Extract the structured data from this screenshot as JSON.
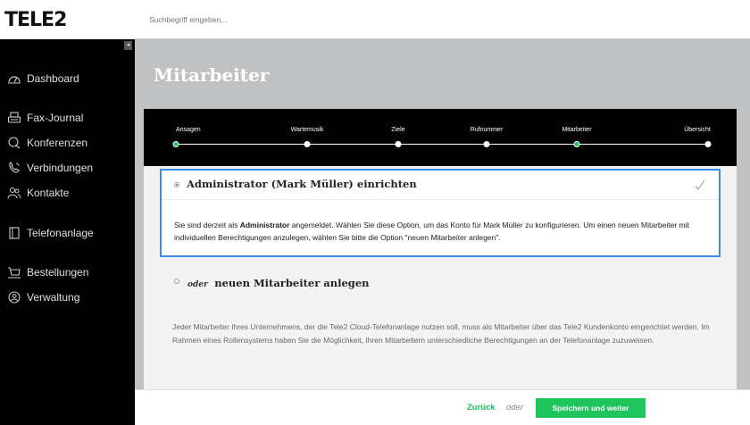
{
  "brand": {
    "logo": "TELE2"
  },
  "search": {
    "placeholder": "Suchbegriff eingeben..."
  },
  "sidebar": {
    "collapse_glyph": "◂",
    "items": [
      {
        "label": "Dashboard",
        "icon": "gauge-icon"
      },
      {
        "label": "Fax-Journal",
        "icon": "fax-icon"
      },
      {
        "label": "Konferenzen",
        "icon": "chat-icon"
      },
      {
        "label": "Verbindungen",
        "icon": "phone-icon"
      },
      {
        "label": "Kontakte",
        "icon": "contacts-icon"
      },
      {
        "label": "Telefonanlage",
        "icon": "phone-system-icon"
      },
      {
        "label": "Bestellungen",
        "icon": "cart-icon"
      },
      {
        "label": "Verwaltung",
        "icon": "user-circle-icon"
      }
    ]
  },
  "main": {
    "title": "Mitarbeiter"
  },
  "steps": {
    "items": [
      {
        "label": "Ansagen",
        "active": true
      },
      {
        "label": "Wartemusik",
        "active": false
      },
      {
        "label": "Ziele",
        "active": false
      },
      {
        "label": "Rufnummer",
        "active": false
      },
      {
        "label": "Mitarbeiter",
        "active": true
      },
      {
        "label": "Übersicht",
        "active": false
      }
    ]
  },
  "option1": {
    "title": "Administrator (Mark Müller) einrichten",
    "desc_part1": "Sie sind derzeit als ",
    "desc_bold": "Administrator",
    "desc_part2": " angemeldet. Wählen Sie diese Option, um das Konto für Mark Müller zu konfigurieren. Um einen neuen Mitarbeiter mit individuellen Berechtigungen anzulegen, wählen Sie bitte die Option \"neuen Mitarbeiter anlegen\".",
    "selected": true
  },
  "option2": {
    "prefix": "oder",
    "title": "neuen Mitarbeiter anlegen",
    "desc": "Jeder Mitarbeiter Ihres Unternehmens, der die Tele2 Cloud-Telefonanlage nutzen soll, muss als Mitarbeiter über das Tele2 Kundenkonto eingerichtet werden. Im Rahmen eines Rollensystems haben Sie die Möglichkeit, Ihren Mitarbeitern unterschiedliche Berechtigungen an der Telefonanlage zuzuweisen.",
    "selected": false
  },
  "footer": {
    "back_label": "Zurück",
    "or_label": "oder",
    "save_label": "Speichern und weiter"
  },
  "colors": {
    "accent": "#1fc45a",
    "selection_border": "#3a8ee6",
    "sidebar_bg": "#000000"
  }
}
